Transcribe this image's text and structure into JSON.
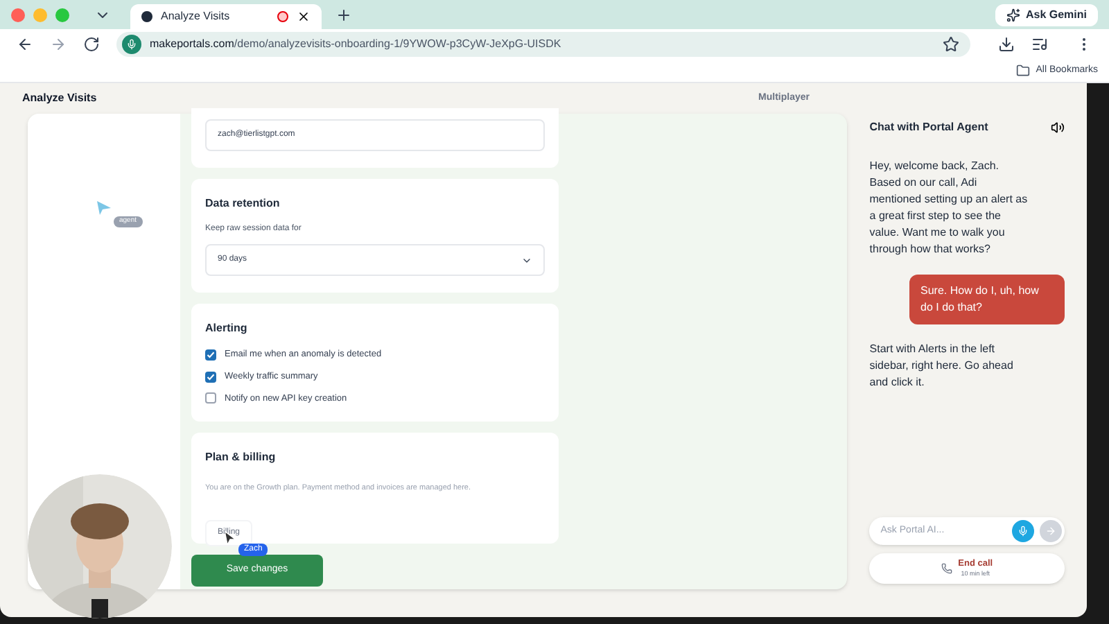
{
  "browser": {
    "tab_title": "Analyze Visits",
    "url_domain": "makeportals.com",
    "url_path": "/demo/analyzevisits-onboarding-1/9YWOW-p3CyW-JeXpG-UISDK",
    "ask_button": "Ask Gemini",
    "bookmarks": "All Bookmarks"
  },
  "app": {
    "title": "Analyze Visits",
    "mode": "Multiplayer"
  },
  "agent_cursor": {
    "label": "agent"
  },
  "email_value": "zach@tierlistgpt.com",
  "retention": {
    "title": "Data retention",
    "label": "Keep raw session data for",
    "value": "90 days"
  },
  "alerting": {
    "title": "Alerting",
    "options": [
      {
        "label": "Email me when an anomaly is detected",
        "checked": true
      },
      {
        "label": "Weekly traffic summary",
        "checked": true
      },
      {
        "label": "Notify on new API key creation",
        "checked": false
      }
    ]
  },
  "billing": {
    "title": "Plan & billing",
    "text": "You are on the Growth plan. Payment method and invoices are managed here.",
    "button": "Billing"
  },
  "user_cursor": {
    "label": "Zach"
  },
  "save_button": "Save changes",
  "chat": {
    "title": "Chat with Portal Agent",
    "messages": [
      {
        "kind": "agent",
        "text": "Hey, welcome back, Zach. Based on our call, Adi mentioned setting up an alert as a great first step to see the value. Want me to walk you through how that works?"
      },
      {
        "kind": "user",
        "text": "Sure. How do I, uh, how do I do that?"
      },
      {
        "kind": "agent",
        "text": "Start with Alerts in the left sidebar, right here. Go ahead and click it."
      }
    ],
    "placeholder": "Ask Portal AI...",
    "end_call": "End call",
    "time_left": "10 min left"
  }
}
